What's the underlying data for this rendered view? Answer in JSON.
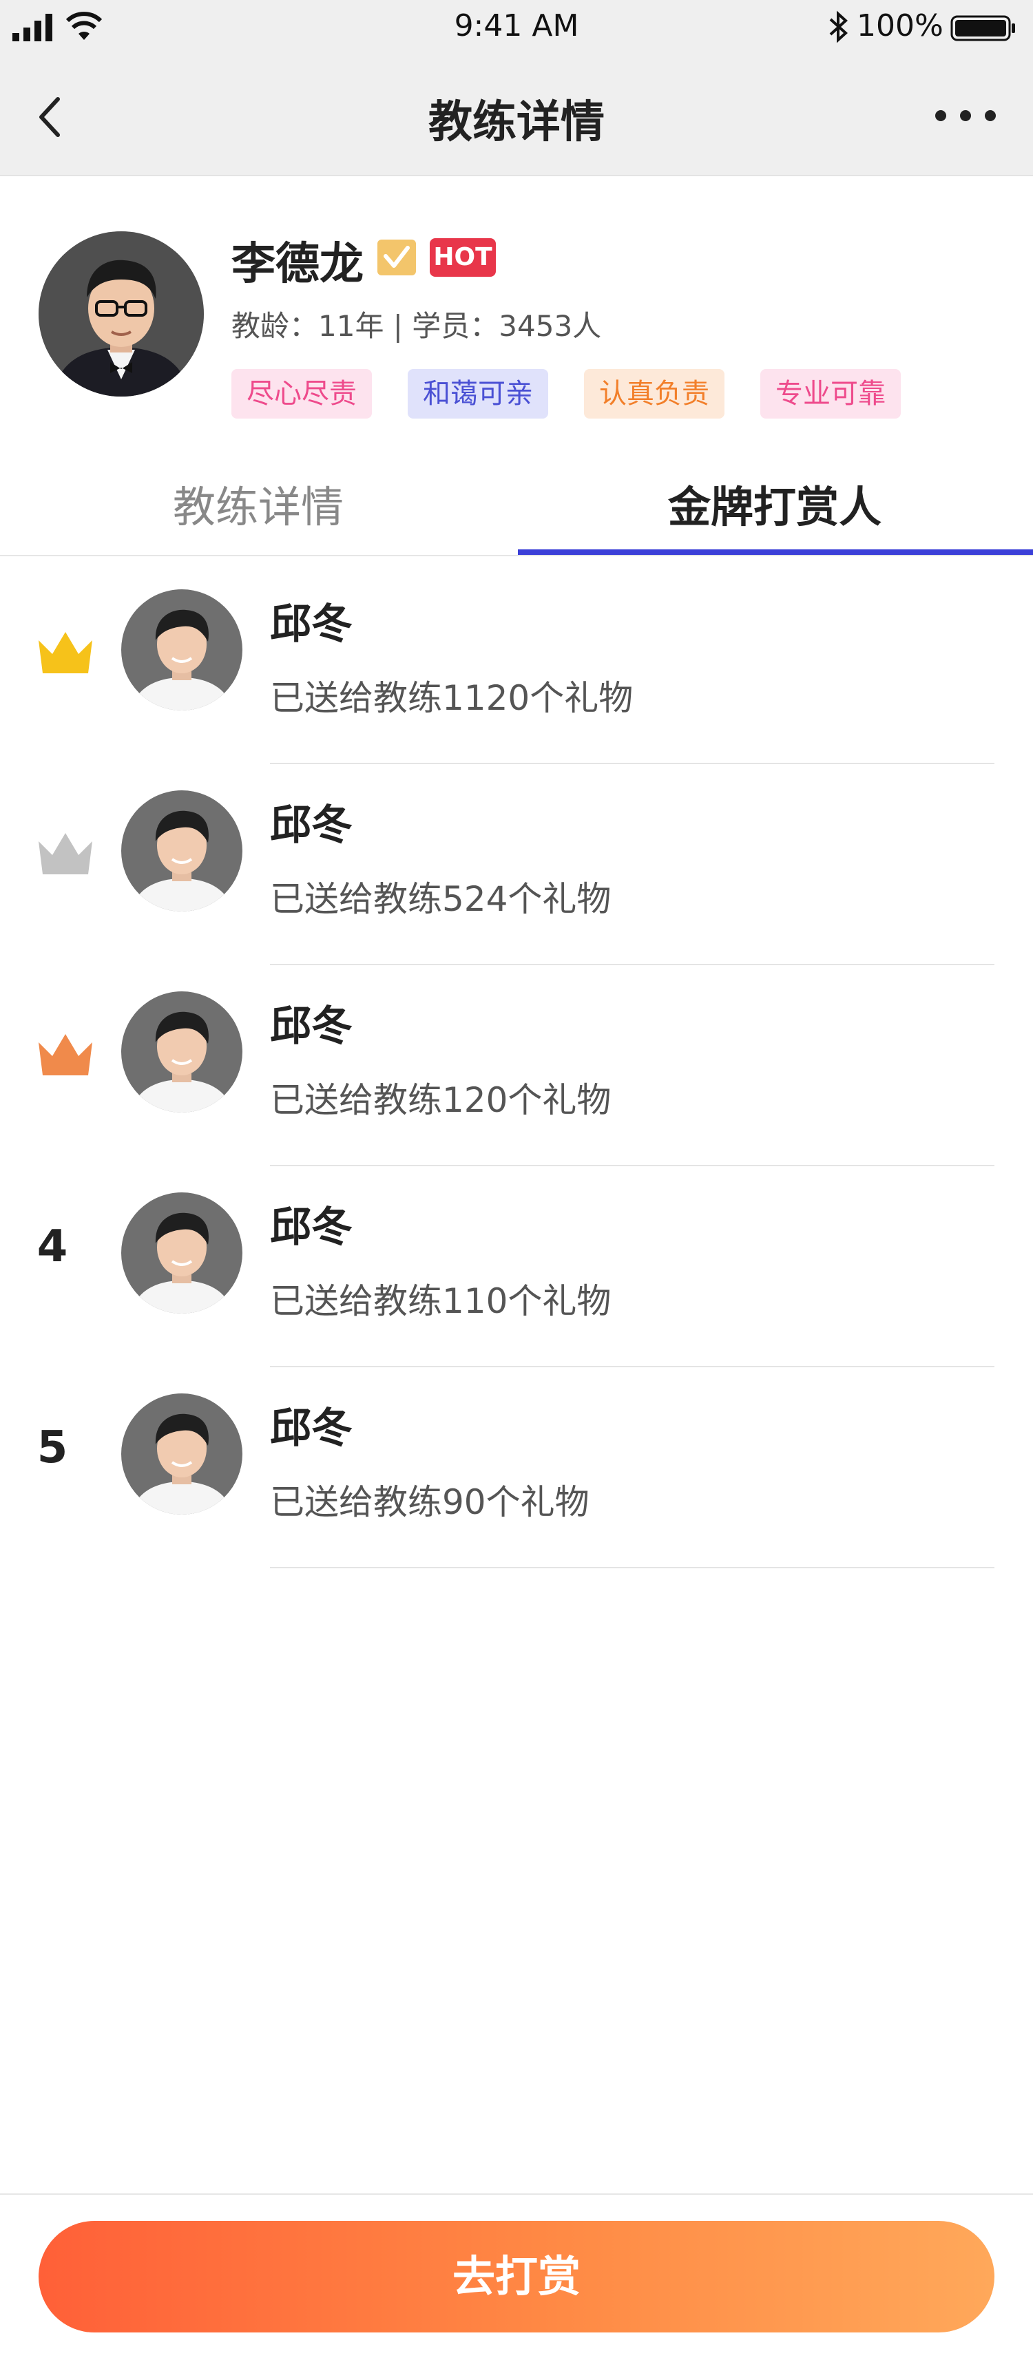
{
  "status_bar": {
    "time": "9:41 AM",
    "battery": "100%"
  },
  "nav": {
    "title": "教练详情"
  },
  "coach": {
    "name": "李德龙",
    "hot_label": "HOT",
    "meta": "教龄：11年 | 学员：3453人",
    "tags": [
      {
        "label": "尽心尽责",
        "bg": "#fde3ee",
        "fg": "#ee4b8c"
      },
      {
        "label": "和蔼可亲",
        "bg": "#e0e2fb",
        "fg": "#4a50d4"
      },
      {
        "label": "认真负责",
        "bg": "#fde9d9",
        "fg": "#f27f2a"
      },
      {
        "label": "专业可靠",
        "bg": "#fde3ee",
        "fg": "#ee4b8c"
      }
    ]
  },
  "tabs": [
    {
      "label": "教练详情",
      "active": false
    },
    {
      "label": "金牌打赏人",
      "active": true
    }
  ],
  "ranking": [
    {
      "rank": "1",
      "badge": "gold-crown",
      "name": "邱冬",
      "gift_text": "已送给教练1120个礼物"
    },
    {
      "rank": "2",
      "badge": "silver-crown",
      "name": "邱冬",
      "gift_text": "已送给教练524个礼物"
    },
    {
      "rank": "3",
      "badge": "bronze-crown",
      "name": "邱冬",
      "gift_text": "已送给教练120个礼物"
    },
    {
      "rank": "4",
      "badge": "",
      "name": "邱冬",
      "gift_text": "已送给教练110个礼物"
    },
    {
      "rank": "5",
      "badge": "",
      "name": "邱冬",
      "gift_text": "已送给教练90个礼物"
    }
  ],
  "crown_colors": {
    "gold": "#f6c21a",
    "silver": "#c2c2c2",
    "bronze": "#f08a4b"
  },
  "accent": "#3b3fd8",
  "bottom": {
    "button_label": "去打赏"
  }
}
